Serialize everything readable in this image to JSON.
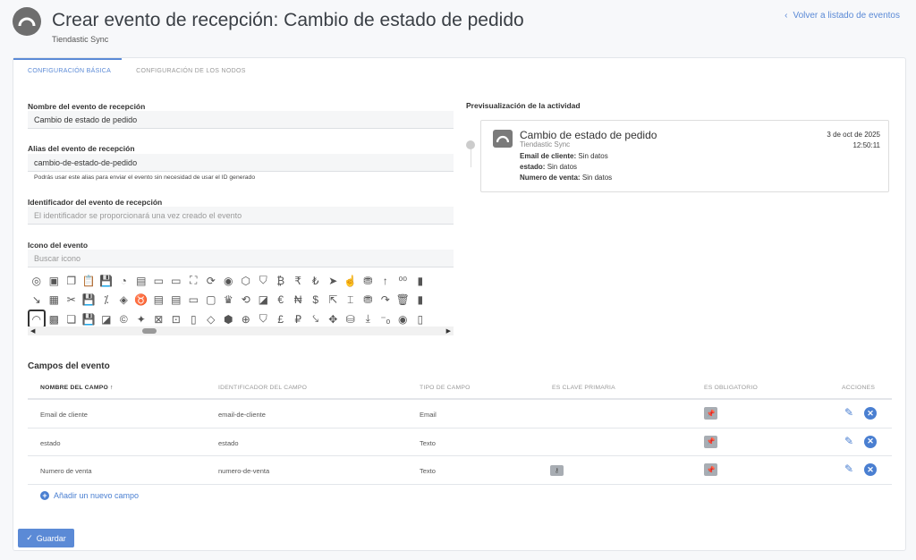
{
  "header": {
    "title": "Crear evento de recepción: Cambio de estado de pedido",
    "subtitle": "Tiendastic Sync",
    "back_link": "Volver a listado de eventos"
  },
  "tabs": [
    {
      "label": "Configuración básica",
      "active": true
    },
    {
      "label": "Configuración de los nodos",
      "active": false
    }
  ],
  "form": {
    "name_label": "Nombre del evento de recepción",
    "name_value": "Cambio de estado de pedido",
    "alias_label": "Alias del evento de recepción",
    "alias_value": "cambio-de-estado-de-pedido",
    "alias_hint": "Podrás usar este alias para enviar el evento sin necesidad de usar el ID generado",
    "id_label": "Identificador del evento de recepción",
    "id_placeholder": "El identificador se proporcionará una vez creado el evento",
    "icon_label": "Icono del evento",
    "icon_search_placeholder": "Buscar icono"
  },
  "icon_picker": {
    "rows": [
      [
        "◎",
        "▣",
        "❐",
        "📋",
        "💾",
        "◔",
        "▤",
        "▭",
        "▭",
        "⛶",
        "⟳",
        "◉",
        "⬡",
        "⛉",
        "₿",
        "₹",
        "₺",
        "➤",
        "☝",
        "⛃",
        "↑",
        "⁰⁰",
        "▮"
      ],
      [
        "↘",
        "▦",
        "✂",
        "💾",
        "⁒",
        "◈",
        "♉",
        "▤",
        "▤",
        "▭",
        "▢",
        "♛",
        "⟲",
        "◪",
        "€",
        "₦",
        "$",
        "⇱",
        "⌶",
        "⛃",
        "↷",
        "🗑",
        "▮"
      ],
      [
        "◠",
        "▩",
        "❏",
        "💾",
        "◪",
        "©",
        "✦",
        "⊠",
        "⊡",
        "▯",
        "◇",
        "⬢",
        "⊕",
        "⛉",
        "£",
        "₽",
        "⤥",
        "✥",
        "⛁",
        "⤓",
        "⁻ₒ",
        "◉",
        "▯"
      ]
    ],
    "selected_row": 2,
    "selected_col": 0
  },
  "preview": {
    "label": "Previsualización de la actividad",
    "title": "Cambio de estado de pedido",
    "source": "Tiendastic Sync",
    "date": "3 de oct de 2025",
    "time": "12:50:11",
    "rows": [
      {
        "key": "Email de cliente:",
        "value": "Sin datos"
      },
      {
        "key": "estado:",
        "value": "Sin datos"
      },
      {
        "key": "Numero de venta:",
        "value": "Sin datos"
      }
    ]
  },
  "fields_section": {
    "title": "Campos del evento",
    "columns": [
      "Nombre del campo ↑",
      "Identificador del campo",
      "Tipo de campo",
      "Es clave primaria",
      "Es obligatorio",
      "Acciones"
    ],
    "rows": [
      {
        "name": "Email de cliente",
        "identifier": "email-de-cliente",
        "type": "Email",
        "primary_key": false,
        "required": true
      },
      {
        "name": "estado",
        "identifier": "estado",
        "type": "Texto",
        "primary_key": false,
        "required": true
      },
      {
        "name": "Numero de venta",
        "identifier": "numero-de-venta",
        "type": "Texto",
        "primary_key": true,
        "required": true
      }
    ],
    "add_label": "Añadir un nuevo campo"
  },
  "save_button": "Guardar"
}
